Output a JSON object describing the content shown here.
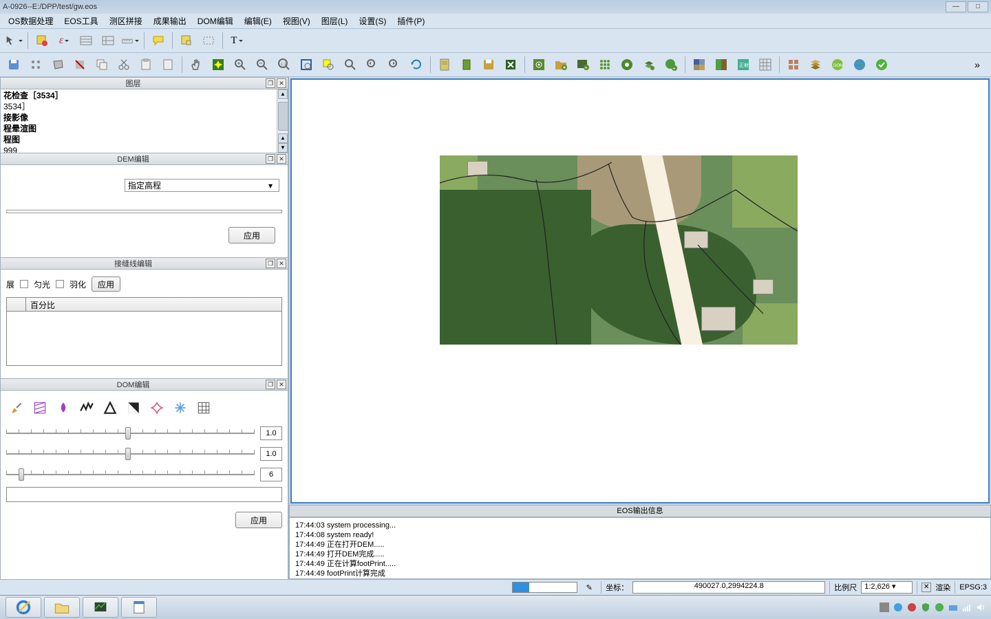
{
  "titlebar": {
    "text": "A-0926--E:/DPP/test/gw.eos"
  },
  "menubar": {
    "items": [
      "OS数据处理",
      "EOS工具",
      "测区拼接",
      "成果输出",
      "DOM编辑",
      "编辑(E)",
      "视图(V)",
      "图层(L)",
      "设置(S)",
      "插件(P)"
    ]
  },
  "panels": {
    "layers": {
      "title": "图层",
      "items": [
        {
          "text": "花检查［3534］",
          "bold": true
        },
        {
          "text": "3534］",
          "bold": false
        },
        {
          "text": "接影像",
          "bold": true
        },
        {
          "text": "程晕渲图",
          "bold": true
        },
        {
          "text": "程图",
          "bold": true
        },
        {
          "text": "999",
          "bold": false
        }
      ]
    },
    "dem": {
      "title": "DEM编辑",
      "select_value": "指定高程",
      "apply": "应用"
    },
    "seam": {
      "title": "接缝线编辑",
      "chk_expand": "展",
      "chk_uniform": "匀光",
      "chk_feather": "羽化",
      "apply": "应用",
      "col_percent": "百分比"
    },
    "dom": {
      "title": "DOM编辑",
      "sliders": [
        {
          "value": "1.0",
          "pos": 0.48
        },
        {
          "value": "1.0",
          "pos": 0.48
        },
        {
          "value": "6",
          "pos": 0.05
        }
      ],
      "apply": "应用"
    }
  },
  "eos_output": {
    "title": "EOS输出信息",
    "lines": [
      "17:44:03 system processing...",
      "17:44:08 system ready!",
      "17:44:49 正在打开DEM.....",
      "17:44:49 打开DEM完成.....",
      "17:44:49 正在计算footPrint.....",
      "17:44:49 footPrint计算完成"
    ]
  },
  "statusbar": {
    "coord_label": "坐标：",
    "coord_value": "490027.0,2994224.8",
    "scale_label": "比例尺",
    "scale_value": "1:2,626",
    "render_label": "渲染",
    "epsg": "EPSG:3"
  },
  "colors": {
    "accent": "#3090e0",
    "panel_bg": "#d8e4f0"
  }
}
